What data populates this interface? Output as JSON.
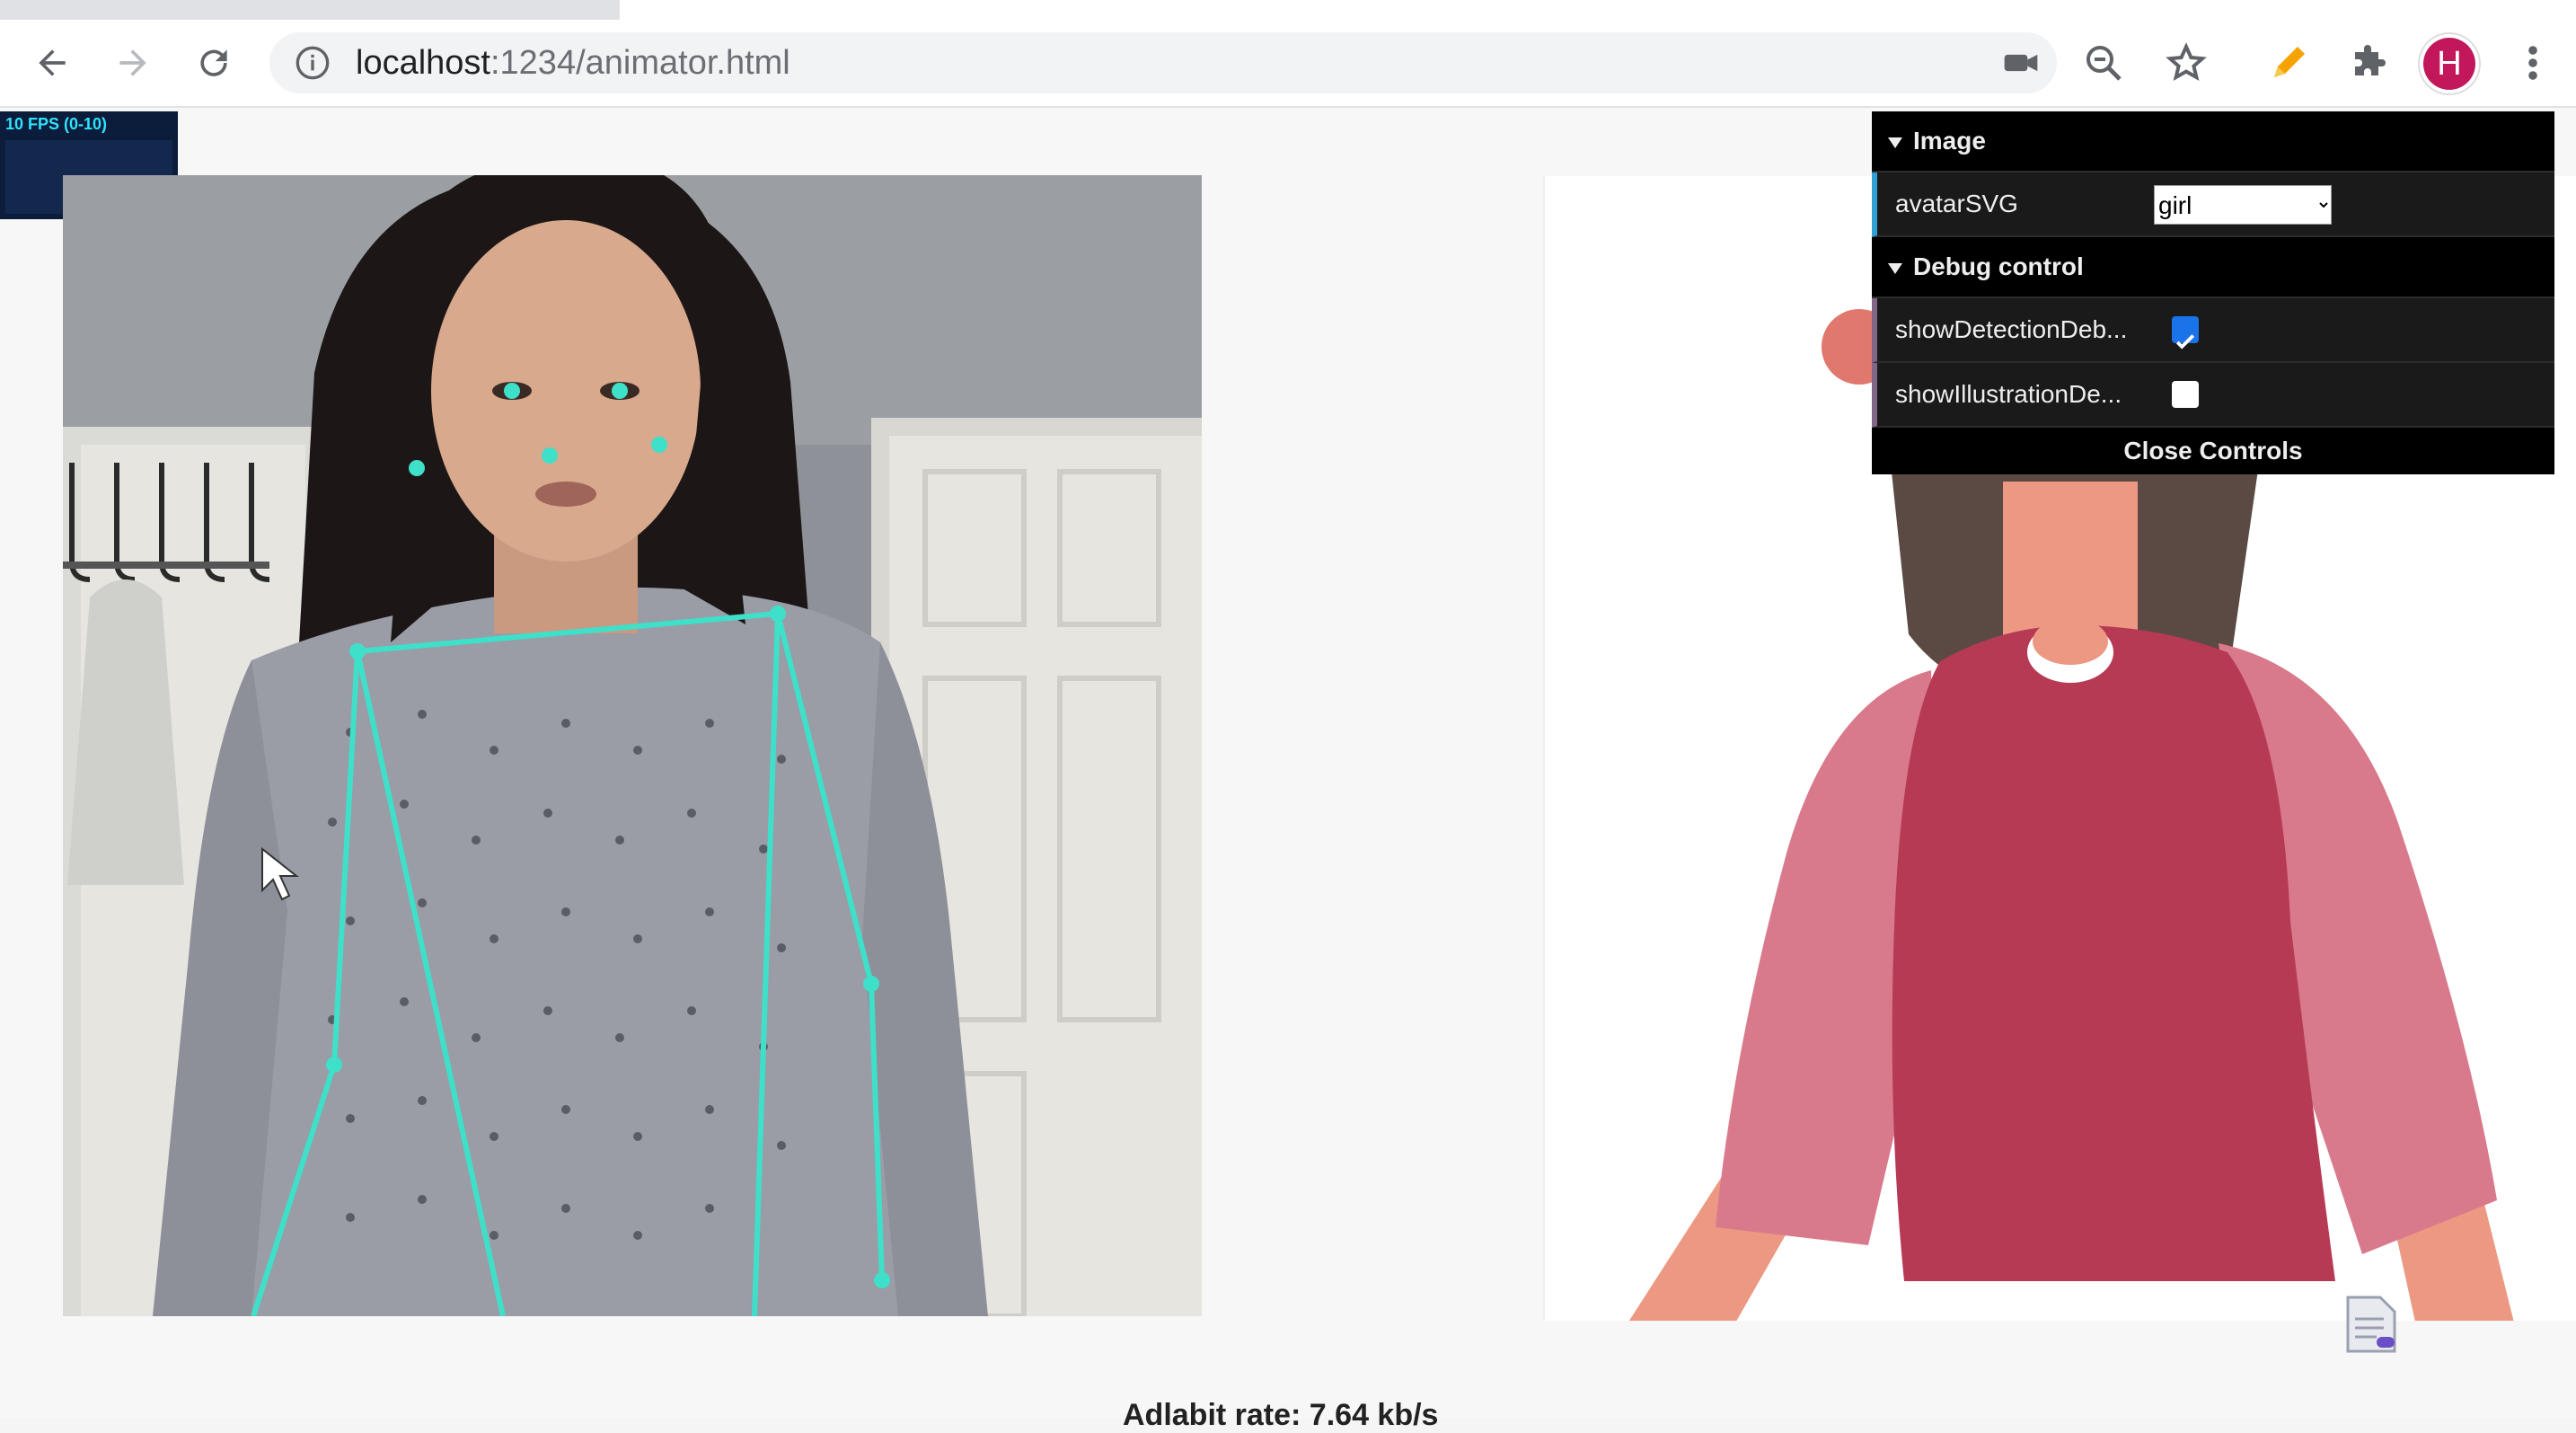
{
  "browser": {
    "url_host": "localhost",
    "url_path": ":1234/animator.html",
    "profile_initial": "H"
  },
  "icons": {
    "back": "arrow-left-icon",
    "forward": "arrow-right-icon",
    "reload": "reload-icon",
    "info": "info-icon",
    "camera": "camera-icon",
    "zoom": "zoom-icon",
    "bookmark": "star-icon",
    "extension_pen": "pen-icon",
    "extensions": "puzzle-icon",
    "menu": "more-vert-icon"
  },
  "stats": {
    "fps_label": "10 FPS (0-10)"
  },
  "controls": {
    "image_folder": "Image",
    "avatar_label": "avatarSVG",
    "avatar_value": "girl",
    "avatar_options": [
      "girl"
    ],
    "debug_folder": "Debug control",
    "show_detection_label": "showDetectionDeb...",
    "show_detection_checked": true,
    "show_illustration_label": "showIllustrationDe...",
    "show_illustration_checked": false,
    "close_label": "Close Controls"
  },
  "footer": {
    "bitrate": "Adlabit rate: 7.64 kb/s"
  },
  "colors": {
    "skeleton": "#3fe0c9",
    "shirt": "#b73a55",
    "sleeve": "#d97a8c",
    "skin": "#ec9882",
    "hair": "#5b4a44",
    "gui_select_accent": "#2fa1d6",
    "gui_bool_accent": "#806787"
  }
}
